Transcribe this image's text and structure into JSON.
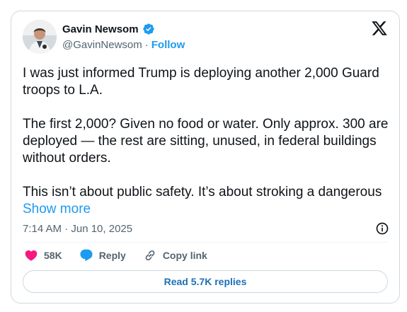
{
  "author": {
    "name": "Gavin Newsom",
    "handle": "@GavinNewsom",
    "separator": "·",
    "follow_label": "Follow"
  },
  "tweet": {
    "paragraph_1": "I was just informed Trump is deploying another 2,000 Guard troops to L.A.",
    "paragraph_2": "The first 2,000? Given no food or water. Only approx. 300 are deployed — the rest are sitting, unused, in federal buildings without orders.",
    "paragraph_3": "This isn’t about public safety. It’s about stroking a dangerous",
    "show_more_label": "Show more"
  },
  "meta": {
    "timestamp": "7:14 AM · Jun 10, 2025"
  },
  "actions": {
    "likes": "58K",
    "reply_label": "Reply",
    "copy_link_label": "Copy link"
  },
  "footer": {
    "read_replies_label": "Read 5.7K replies"
  },
  "colors": {
    "accent": "#1d9bf0",
    "like": "#f91880",
    "text": "#0f1419",
    "muted": "#536471",
    "border": "#cfd9de"
  },
  "icons": {
    "verified": "verified-badge-icon",
    "x_logo": "x-logo-icon",
    "info": "info-icon",
    "like": "heart-icon",
    "reply": "speech-bubble-icon",
    "copy_link": "link-icon"
  }
}
